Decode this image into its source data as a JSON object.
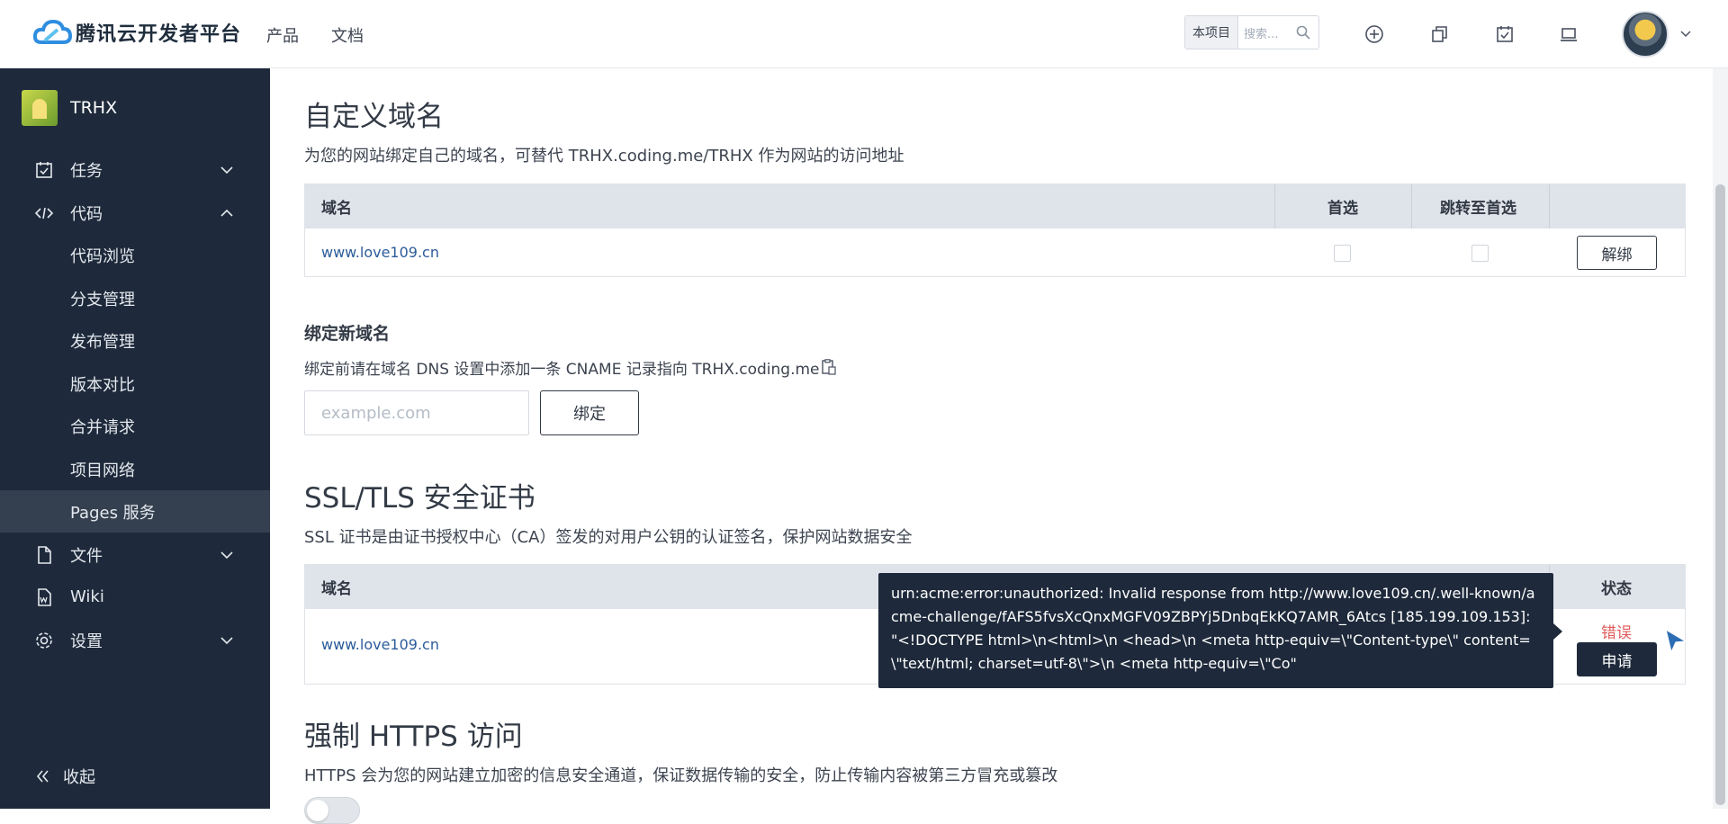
{
  "topbar": {
    "brand": "腾讯云开发者平台",
    "nav": [
      "产品",
      "文档"
    ],
    "search_scope": "本项目",
    "search_placeholder": "搜索..."
  },
  "sidebar": {
    "project_name": "TRHX",
    "items": {
      "tasks": "任务",
      "code": "代码",
      "files": "文件",
      "wiki": "Wiki",
      "settings": "设置"
    },
    "code_sub": [
      "代码浏览",
      "分支管理",
      "发布管理",
      "版本对比",
      "合并请求",
      "项目网络",
      "Pages 服务"
    ],
    "active_sub": "Pages 服务",
    "collapse": "收起"
  },
  "custom_domain": {
    "title": "自定义域名",
    "desc": "为您的网站绑定自己的域名，可替代 TRHX.coding.me/TRHX 作为网站的访问地址",
    "headers": [
      "域名",
      "首选",
      "跳转至首选"
    ],
    "rows": [
      {
        "domain": "www.love109.cn",
        "unbind_label": "解绑"
      }
    ]
  },
  "bind_new": {
    "title": "绑定新域名",
    "desc": "绑定前请在域名 DNS 设置中添加一条 CNAME 记录指向 TRHX.coding.me",
    "placeholder": "example.com",
    "button": "绑定"
  },
  "ssl": {
    "title": "SSL/TLS 安全证书",
    "desc": "SSL 证书是由证书授权中心（CA）签发的对用户公钥的认证签名，保护网站数据安全",
    "headers": [
      "域名",
      "状态"
    ],
    "rows": [
      {
        "domain": "www.love109.cn",
        "status": "错误",
        "apply_label": "申请"
      }
    ],
    "tooltip": "urn:acme:error:unauthorized: Invalid response from http://www.love109.cn/.well-known/acme-challenge/fAFS5fvsXcQnxMGFV09ZBPYj5DnbqEkKQ7AMR_6Atcs [185.199.109.153]: \"<!DOCTYPE html>\\n<html>\\n <head>\\n <meta http-equiv=\\\"Content-type\\\" content=\\\"text/html; charset=utf-8\\\">\\n <meta http-equiv=\\\"Co\""
  },
  "https": {
    "title": "强制 HTTPS 访问",
    "desc": "HTTPS 会为您的网站建立加密的信息安全通道，保证数据传输的安全，防止传输内容被第三方冒充或篡改"
  },
  "colors": {
    "sidebar_bg": "#1e2a3b",
    "active_bg": "#34404f",
    "link": "#2c5b9a",
    "error": "#e05a5a",
    "header_bg": "#dfe3ea"
  }
}
